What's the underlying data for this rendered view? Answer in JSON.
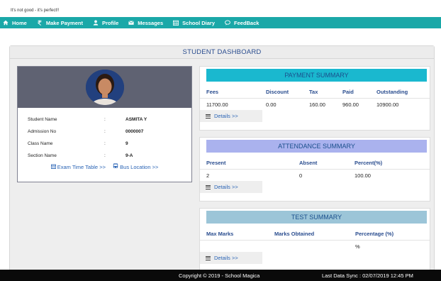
{
  "tagline": "It's not good - it's perfect!!",
  "nav": {
    "items": [
      {
        "label": "Home",
        "icon": "home-icon"
      },
      {
        "label": "Make Payment",
        "icon": "rupee-icon"
      },
      {
        "label": "Profile",
        "icon": "user-icon"
      },
      {
        "label": "Messages",
        "icon": "envelope-icon"
      },
      {
        "label": "School Diary",
        "icon": "calendar-icon"
      },
      {
        "label": "FeedBack",
        "icon": "chat-icon"
      }
    ],
    "color": "#1aa8a8"
  },
  "dashboard": {
    "title": "STUDENT DASHBOARD"
  },
  "student": {
    "rows": [
      {
        "label": "Student Name",
        "sep": ":",
        "value": "ASMITA Y"
      },
      {
        "label": "Admission No",
        "sep": ":",
        "value": "0000007"
      },
      {
        "label": "Class Name",
        "sep": ":",
        "value": "9"
      },
      {
        "label": "Section Name",
        "sep": ":",
        "value": "9-A"
      }
    ],
    "links": {
      "timetable": "Exam Time Table >>",
      "bus": "Bus Location >>"
    }
  },
  "payment": {
    "title": "PAYMENT SUMMARY",
    "color": "#1ab8cf",
    "headers": [
      "Fees",
      "Discount",
      "Tax",
      "Paid",
      "Outstanding"
    ],
    "row": [
      "11700.00",
      "0.00",
      "160.00",
      "960.00",
      "10900.00"
    ],
    "details": "Details >>"
  },
  "attendance": {
    "title": "ATTENDANCE SUMMARY",
    "color": "#aab2ee",
    "headers": [
      "Present",
      "Absent",
      "Percent(%)"
    ],
    "row": [
      "2",
      "0",
      "100.00"
    ],
    "details": "Details >>"
  },
  "test": {
    "title": "TEST SUMMARY",
    "color": "#9cc5d8",
    "headers": [
      "Max Marks",
      "Marks Obtained",
      "Percentage (%)"
    ],
    "row": [
      "",
      "",
      "%"
    ],
    "details": "Details >>"
  },
  "footer": {
    "copyright": "Copyright © 2019 - School Magica",
    "sync": "Last Data Sync : 02/07/2019 12:45 PM"
  }
}
